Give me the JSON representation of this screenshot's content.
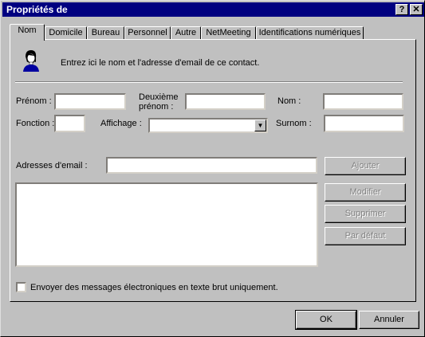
{
  "window": {
    "title": "Propriétés de",
    "help": "?",
    "close": "✕"
  },
  "tabs": [
    {
      "label": "Nom"
    },
    {
      "label": "Domicile"
    },
    {
      "label": "Bureau"
    },
    {
      "label": "Personnel"
    },
    {
      "label": "Autre"
    },
    {
      "label": "NetMeeting"
    },
    {
      "label": "Identifications numériques"
    }
  ],
  "intro": {
    "text": "Entrez ici le nom et l'adresse d'email de ce contact.",
    "icon": "person-icon"
  },
  "fields": {
    "prenom_label": "Prénom :",
    "deuxieme_label_1": "Deuxième",
    "deuxieme_label_2": "prénom :",
    "nom_label": "Nom :",
    "fonction_label": "Fonction :",
    "affichage_label": "Affichage :",
    "surnom_label": "Surnom :",
    "email_label": "Adresses d'email :"
  },
  "buttons": {
    "ajouter": "Ajouter",
    "modifier": "Modifier",
    "supprimer": "Supprimer",
    "par_defaut": "Par défaut",
    "ok": "OK",
    "annuler": "Annuler"
  },
  "checkbox": {
    "label": "Envoyer des messages électroniques en texte brut uniquement.",
    "checked": false
  },
  "colors": {
    "titlebar": "#000080",
    "face": "#c0c0c0"
  }
}
